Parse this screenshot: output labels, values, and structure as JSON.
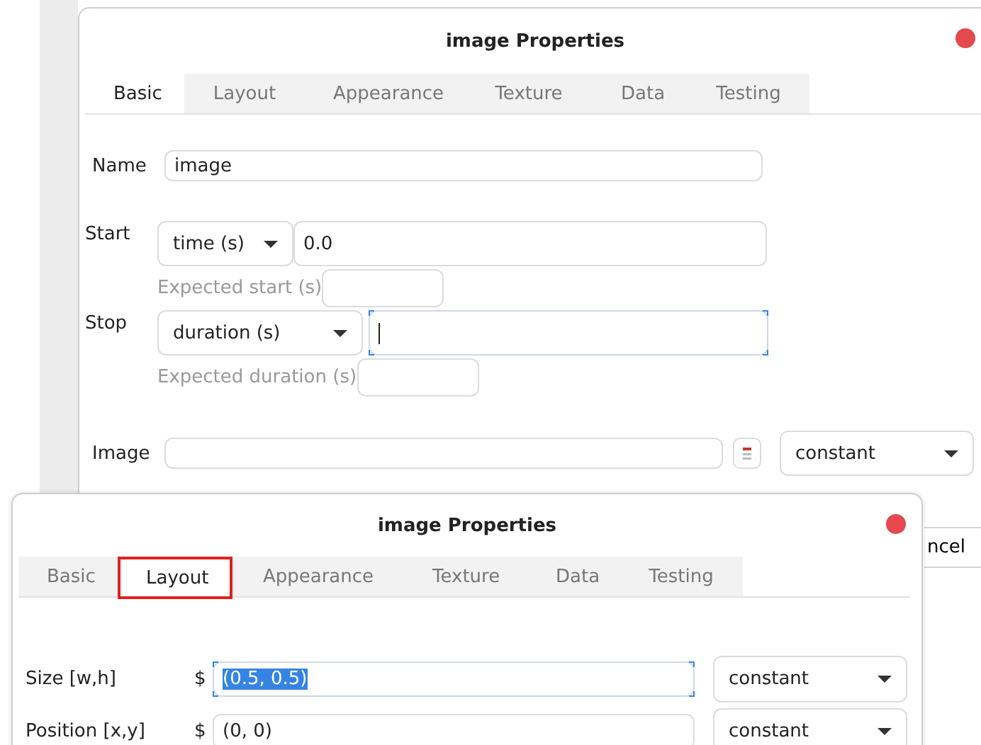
{
  "back_dialog": {
    "title": "image Properties",
    "tabs": [
      {
        "label": "Basic",
        "selected": true
      },
      {
        "label": "Layout",
        "selected": false
      },
      {
        "label": "Appearance",
        "selected": false
      },
      {
        "label": "Texture",
        "selected": false
      },
      {
        "label": "Data",
        "selected": false
      },
      {
        "label": "Testing",
        "selected": false
      }
    ],
    "name": {
      "label": "Name",
      "value": "image"
    },
    "start": {
      "label": "Start",
      "mode": "time (s)",
      "value": "0.0",
      "focused": false,
      "expected_label": "Expected start (s)"
    },
    "stop": {
      "label": "Stop",
      "mode": "duration (s)",
      "focused": true,
      "expected_label": "Expected duration (s)"
    },
    "image": {
      "label": "Image",
      "mode": "constant"
    },
    "cancel_button": "ncel"
  },
  "front_dialog": {
    "title": "image Properties",
    "tabs": [
      {
        "label": "Basic",
        "selected": false,
        "highlighted": false
      },
      {
        "label": "Layout",
        "selected": true,
        "highlighted": true
      },
      {
        "label": "Appearance",
        "selected": false,
        "highlighted": false
      },
      {
        "label": "Texture",
        "selected": false,
        "highlighted": false
      },
      {
        "label": "Data",
        "selected": false,
        "highlighted": false
      },
      {
        "label": "Testing",
        "selected": false,
        "highlighted": false
      }
    ],
    "rows": [
      {
        "label": "Size [w,h]",
        "prefix": "$",
        "value": "(0.5, 0.5)",
        "focused": true,
        "value_selected": true,
        "mode": "constant"
      },
      {
        "label": "Position [x,y]",
        "prefix": "$",
        "value": "(0, 0)",
        "focused": false,
        "value_selected": false,
        "mode": "constant"
      }
    ]
  }
}
